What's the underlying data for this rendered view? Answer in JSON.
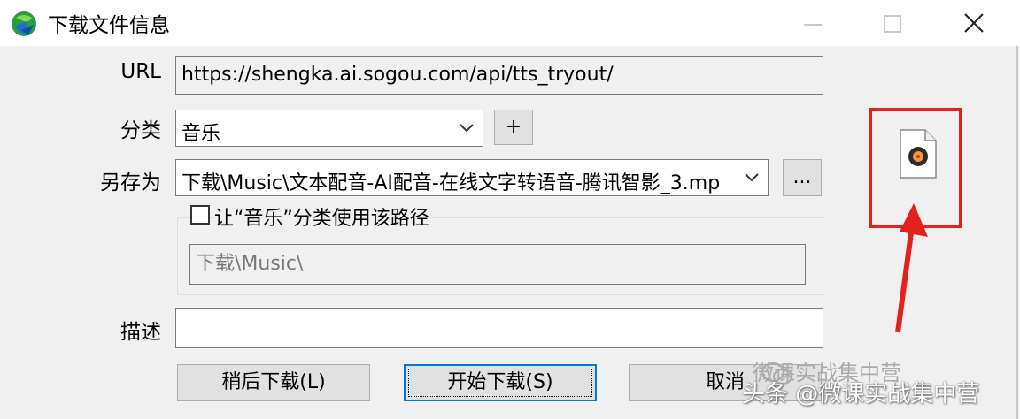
{
  "window": {
    "title": "下载文件信息",
    "icons": {
      "app": "idm-globe-icon",
      "minimize": "minimize-icon",
      "maximize": "maximize-icon",
      "close": "close-icon"
    }
  },
  "form": {
    "url_label": "URL",
    "url_value": "https://shengka.ai.sogou.com/api/tts_tryout/",
    "category_label": "分类",
    "category_value": "音乐",
    "add_category_label": "+",
    "saveas_label": "另存为",
    "saveas_value": "下载\\Music\\文本配音-AI配音-在线文字转语音-腾讯智影_3.mp",
    "browse_label": "...",
    "checkbox_label": "让“音乐”分类使用该路径",
    "checkbox_checked": false,
    "default_path_value": "下载\\Music\\",
    "description_label": "描述",
    "description_value": ""
  },
  "buttons": {
    "later": "稍后下载(L)",
    "start": "开始下载(S)",
    "cancel": "取消"
  },
  "annotation": {
    "highlight_color": "#e3211d",
    "file_icon": "music-file-icon",
    "arrow_icon": "red-arrow-icon"
  },
  "watermark": {
    "top": "微课实战集中营",
    "bottom": "头条 @微课实战集中营",
    "icon": "wechat-icon"
  }
}
